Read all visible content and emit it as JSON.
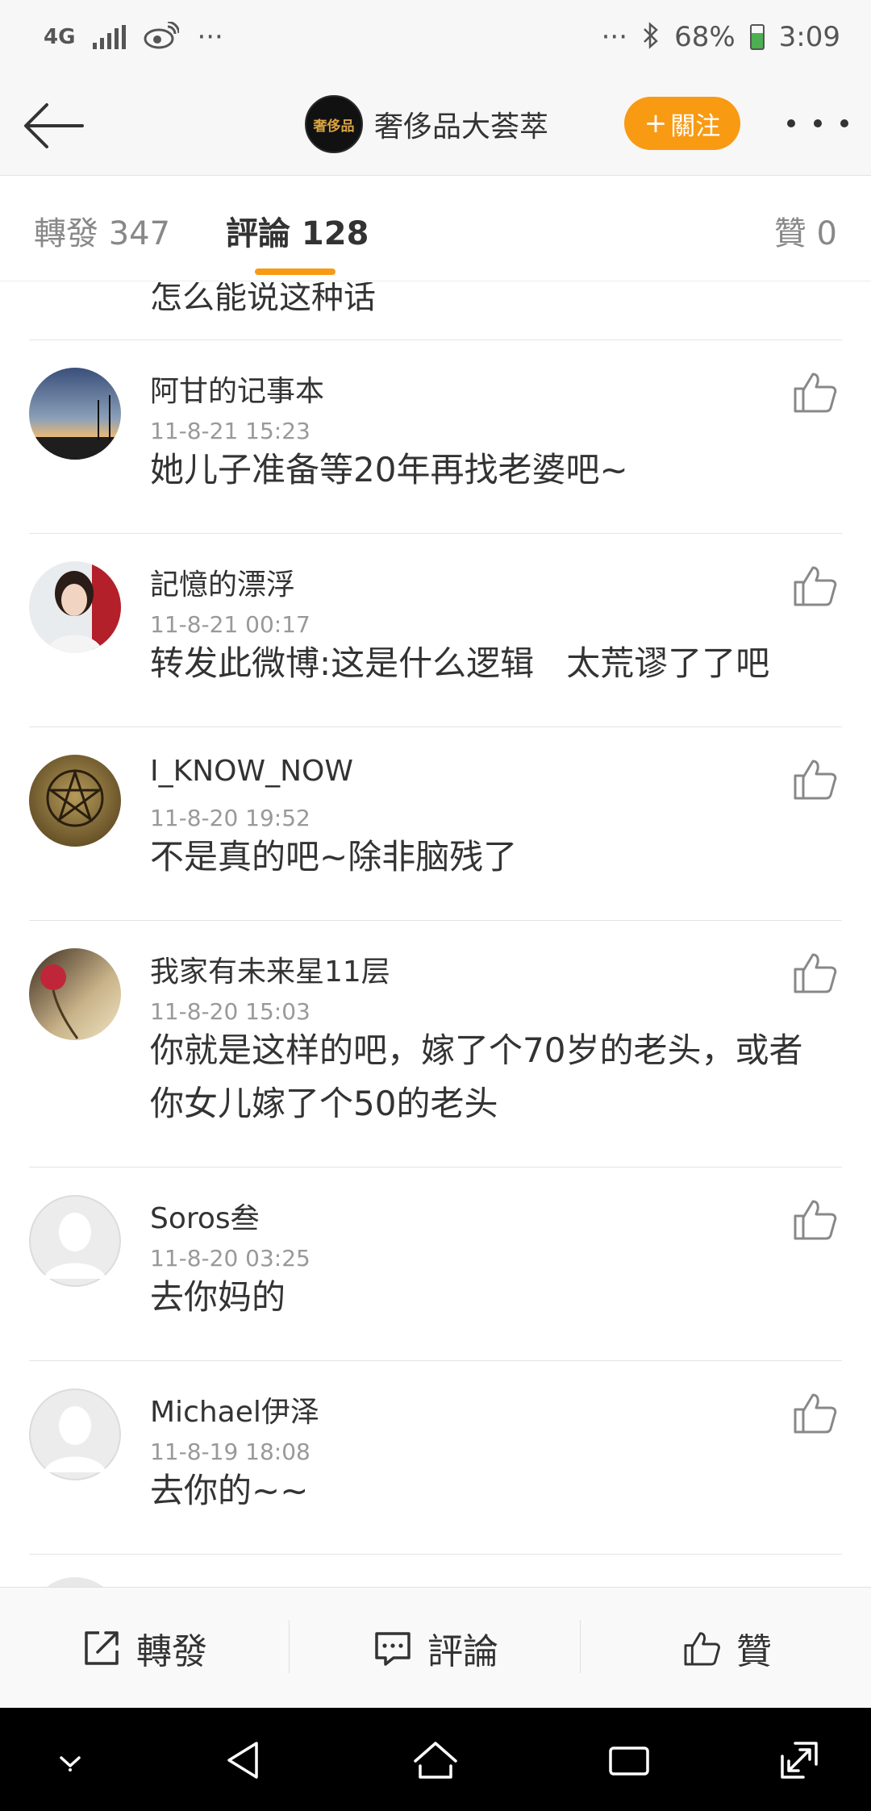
{
  "status_bar": {
    "network": "4G",
    "overflow": "···",
    "overflow_right": "···",
    "battery": "68%",
    "time": "3:09",
    "icons": [
      "signal-icon",
      "weibo-icon",
      "bluetooth-icon",
      "battery-icon"
    ]
  },
  "nav": {
    "title": "奢侈品大荟萃",
    "logo_text": "奢侈品",
    "follow_label": "關注",
    "follow_plus": "+"
  },
  "tabs": [
    {
      "label": "轉發 347"
    },
    {
      "label": "評論 128"
    },
    {
      "label": "贊 0"
    }
  ],
  "active_tab": "評論 128",
  "comments_prev_tail": "怎么能说这种话",
  "comments": [
    {
      "name": "阿甘的记事本",
      "time": "11-8-21 15:23",
      "text": "她儿子准备等20年再找老婆吧~"
    },
    {
      "name": "記憶的漂浮",
      "time": "11-8-21 00:17",
      "text": "转发此微博:这是什么逻辑   太荒谬了了吧"
    },
    {
      "name": "I_KNOW_NOW",
      "time": "11-8-20 19:52",
      "text": "不是真的吧~除非脑残了"
    },
    {
      "name": "我家有未来星11层",
      "time": "11-8-20 15:03",
      "text": "你就是这样的吧，嫁了个70岁的老头，或者你女儿嫁了个50的老头"
    },
    {
      "name": "Soros叁",
      "time": "11-8-20 03:25",
      "text": "去你妈的"
    },
    {
      "name": "Michael伊泽",
      "time": "11-8-19 18:08",
      "text": "去你的~~"
    }
  ],
  "bottom_bar": {
    "repost": "轉發",
    "comment": "評論",
    "like": "贊"
  },
  "colors": {
    "accent": "#f99a13",
    "text": "#333333",
    "meta": "#999999"
  }
}
